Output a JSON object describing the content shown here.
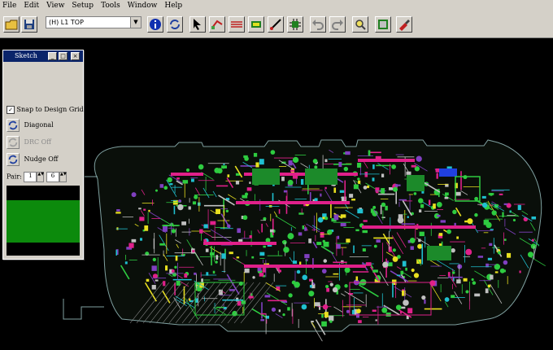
{
  "menu": [
    "File",
    "Edit",
    "View",
    "Setup",
    "Tools",
    "Window",
    "Help"
  ],
  "toolbar": {
    "layer_select": "(H) L1 TOP",
    "buttons": [
      "open-icon",
      "save-icon",
      "info-icon",
      "refresh-icon",
      "select-arrow-icon",
      "route-icon",
      "bus-route-icon",
      "pin-icon",
      "trace-icon",
      "component-icon",
      "undo-icon",
      "redo-icon",
      "zoom-icon",
      "board-icon",
      "drc-icon"
    ]
  },
  "palette": {
    "title": "Sketch",
    "snap_label": "Snap to Design Grid",
    "snap_checked": true,
    "diagonal_label": "Diagonal",
    "drc_label": "DRC Off",
    "nudge_label": "Nudge Off",
    "pair_label": "Pair:",
    "pair_from": "1",
    "pair_to": "6"
  },
  "colors": {
    "window_bg": "#d4d0c8",
    "canvas_bg": "#000000",
    "title_bar": "#0a246a",
    "layer_green": "#0c8a0c",
    "trace_green": "#2ecc40",
    "trace_magenta": "#e0208a",
    "trace_cyan": "#20c0d0",
    "trace_yellow": "#e8e020"
  }
}
